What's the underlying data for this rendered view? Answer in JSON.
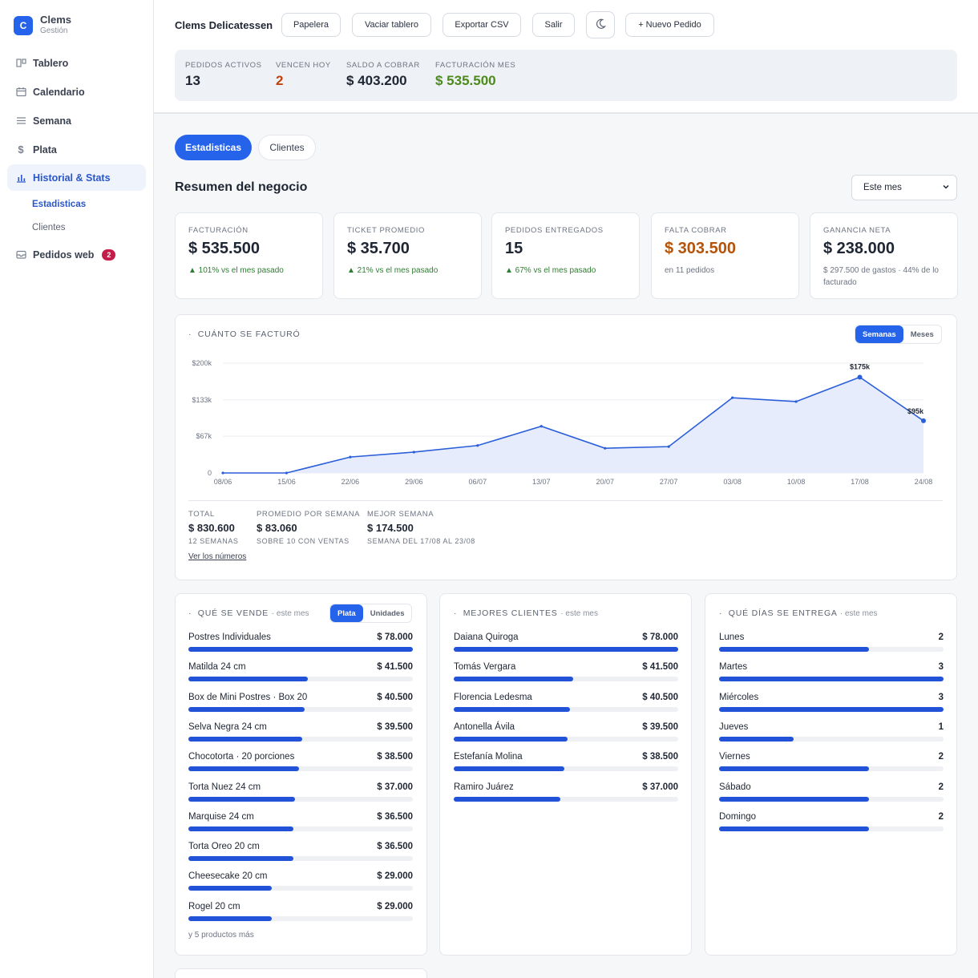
{
  "brand": {
    "logo": "C",
    "name": "Clems",
    "sub": "Gestión"
  },
  "nav": [
    {
      "label": "Tablero",
      "icon": "board-icon"
    },
    {
      "label": "Calendario",
      "icon": "calendar-icon"
    },
    {
      "label": "Semana",
      "icon": "list-icon"
    },
    {
      "label": "Plata",
      "icon": "dollar-icon"
    },
    {
      "label": "Historial & Stats",
      "icon": "bar-chart-icon",
      "active": true
    },
    {
      "label": "Pedidos web",
      "icon": "inbox-icon",
      "badge": "2"
    }
  ],
  "subnav": [
    {
      "label": "Estadisticas",
      "active": true
    },
    {
      "label": "Clientes"
    }
  ],
  "header": {
    "title": "Clems Delicatessen",
    "buttons": [
      "Papelera",
      "Vaciar tablero",
      "Exportar CSV",
      "Salir"
    ],
    "new_order": "+ Nuevo Pedido"
  },
  "summary": [
    {
      "label": "PEDIDOS ACTIVOS",
      "value": "13",
      "color": "#1f2633"
    },
    {
      "label": "VENCEN HOY",
      "value": "2",
      "color": "#c2410c"
    },
    {
      "label": "SALDO A COBRAR",
      "value": "$ 403.200",
      "color": "#1f2633"
    },
    {
      "label": "FACTURACIÓN MES",
      "value": "$ 535.500",
      "color": "#4d8a1c"
    }
  ],
  "tabs": [
    "Estadisticas",
    "Clientes"
  ],
  "section": {
    "title": "Resumen del negocio",
    "period": "Este mes"
  },
  "kpis": [
    {
      "label": "FACTURACIÓN",
      "value": "$ 535.500",
      "note": "▲ 101% vs el mes pasado",
      "value_color": "#1f2633",
      "note_color": "#2e7d32"
    },
    {
      "label": "TICKET PROMEDIO",
      "value": "$ 35.700",
      "note": "▲ 21% vs el mes pasado",
      "value_color": "#1f2633",
      "note_color": "#2e7d32"
    },
    {
      "label": "PEDIDOS ENTREGADOS",
      "value": "15",
      "note": "▲ 67% vs el mes pasado",
      "value_color": "#1f2633",
      "note_color": "#2e7d32"
    },
    {
      "label": "FALTA COBRAR",
      "value": "$ 303.500",
      "note": "en 11 pedidos",
      "value_color": "#b45309",
      "note_color": "#6d7482"
    },
    {
      "label": "GANANCIA NETA",
      "value": "$ 238.000",
      "note": "$ 297.500 de gastos · 44% de lo facturado",
      "value_color": "#1f2633",
      "note_color": "#6d7482"
    }
  ],
  "revenue": {
    "title": "CUÁNTO SE FACTURÓ",
    "toggle": [
      "Semanas",
      "Meses"
    ],
    "stats": [
      {
        "label": "TOTAL",
        "value": "$ 830.600",
        "sub": "12 SEMANAS"
      },
      {
        "label": "PROMEDIO POR SEMANA",
        "value": "$ 83.060",
        "sub": "SOBRE 10 CON VENTAS"
      },
      {
        "label": "MEJOR SEMANA",
        "value": "$ 174.500",
        "sub": "SEMANA DEL 17/08 AL 23/08"
      }
    ],
    "link": "Ver los números"
  },
  "chart_data": {
    "type": "area",
    "categories": [
      "08/06",
      "15/06",
      "22/06",
      "29/06",
      "06/07",
      "13/07",
      "20/07",
      "27/07",
      "03/08",
      "10/08",
      "17/08",
      "24/08"
    ],
    "values": [
      0,
      0,
      29000,
      38000,
      50000,
      85000,
      45000,
      48000,
      137000,
      130000,
      174500,
      95000
    ],
    "ylim": [
      0,
      200000
    ],
    "yticks": [
      {
        "v": 0,
        "label": "0"
      },
      {
        "v": 67000,
        "label": "$67k"
      },
      {
        "v": 133000,
        "label": "$133k"
      },
      {
        "v": 200000,
        "label": "$200k"
      }
    ],
    "annotations": [
      {
        "index": 10,
        "label": "$175k"
      },
      {
        "index": 11,
        "label": "$95k"
      }
    ],
    "grid": true,
    "color": "#2b5fd9"
  },
  "products": {
    "title": "QUÉ SE VENDE",
    "muted": "· este mes",
    "toggle": [
      "Plata",
      "Unidades"
    ],
    "items": [
      {
        "name": "Postres Individuales",
        "value": "$ 78.000",
        "fraction": 1.0
      },
      {
        "name": "Matilda 24 cm",
        "value": "$ 41.500",
        "fraction": 0.532
      },
      {
        "name": "Box de Mini Postres · Box 20",
        "value": "$ 40.500",
        "fraction": 0.519
      },
      {
        "name": "Selva Negra 24 cm",
        "value": "$ 39.500",
        "fraction": 0.506
      },
      {
        "name": "Chocotorta · 20 porciones",
        "value": "$ 38.500",
        "fraction": 0.494
      },
      {
        "name": "Torta Nuez 24 cm",
        "value": "$ 37.000",
        "fraction": 0.474
      },
      {
        "name": "Marquise 24 cm",
        "value": "$ 36.500",
        "fraction": 0.468
      },
      {
        "name": "Torta Oreo 20 cm",
        "value": "$ 36.500",
        "fraction": 0.468
      },
      {
        "name": "Cheesecake 20 cm",
        "value": "$ 29.000",
        "fraction": 0.372
      },
      {
        "name": "Rogel 20 cm",
        "value": "$ 29.000",
        "fraction": 0.372
      }
    ],
    "more": "y 5 productos más"
  },
  "clients": {
    "title": "MEJORES CLIENTES",
    "muted": "· este mes",
    "items": [
      {
        "name": "Daiana Quiroga",
        "value": "$ 78.000",
        "fraction": 1.0
      },
      {
        "name": "Tomás Vergara",
        "value": "$ 41.500",
        "fraction": 0.532
      },
      {
        "name": "Florencia Ledesma",
        "value": "$ 40.500",
        "fraction": 0.519
      },
      {
        "name": "Antonella Ávila",
        "value": "$ 39.500",
        "fraction": 0.506
      },
      {
        "name": "Estefanía Molina",
        "value": "$ 38.500",
        "fraction": 0.494
      },
      {
        "name": "Ramiro Juárez",
        "value": "$ 37.000",
        "fraction": 0.474
      }
    ]
  },
  "days": {
    "title": "QUÉ DÍAS SE ENTREGA",
    "muted": "· este mes",
    "items": [
      {
        "name": "Lunes",
        "value": "2",
        "fraction": 0.667
      },
      {
        "name": "Martes",
        "value": "3",
        "fraction": 1.0
      },
      {
        "name": "Miércoles",
        "value": "3",
        "fraction": 1.0
      },
      {
        "name": "Jueves",
        "value": "1",
        "fraction": 0.333
      },
      {
        "name": "Viernes",
        "value": "2",
        "fraction": 0.667
      },
      {
        "name": "Sábado",
        "value": "2",
        "fraction": 0.667
      },
      {
        "name": "Domingo",
        "value": "2",
        "fraction": 0.667
      }
    ]
  }
}
